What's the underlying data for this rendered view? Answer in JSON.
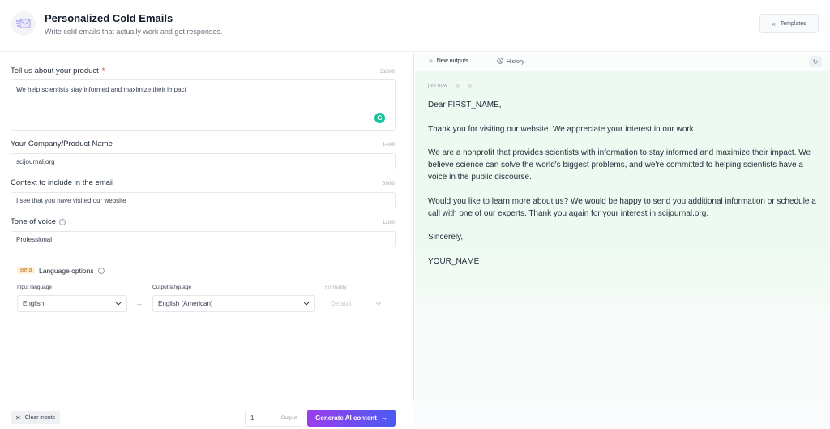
{
  "header": {
    "title": "Personalized Cold Emails",
    "subtitle": "Write cold emails that actually work and get responses.",
    "templates_label": "Templates"
  },
  "form": {
    "product": {
      "label": "Tell us about your product",
      "required_mark": "*",
      "counter": "58/600",
      "value": "We help scientists stay informed and maximize their impact"
    },
    "company": {
      "label": "Your Company/Product Name",
      "counter": "14/80",
      "value": "scijournal.org"
    },
    "context": {
      "label": "Context to include in the email",
      "counter": "39/80",
      "value": "I see that you have visited our website"
    },
    "tone": {
      "label": "Tone of voice",
      "counter": "12/80",
      "value": "Professional"
    },
    "language": {
      "beta_label": "Beta",
      "title": "Language options",
      "input_label": "Input language",
      "input_value": "English",
      "output_label": "Output language",
      "output_value": "English (American)",
      "formality_label": "Formality",
      "formality_value": "Default"
    }
  },
  "footer": {
    "clear_label": "Clear inputs",
    "output_count": "1",
    "output_unit": "Output",
    "generate_label": "Generate AI content"
  },
  "output": {
    "tabs": [
      {
        "label": "New outputs"
      },
      {
        "label": "History"
      }
    ],
    "timestamp": "just now",
    "email_paragraphs": [
      "Dear FIRST_NAME,",
      "Thank you for visiting our website. We appreciate your interest in our work.",
      "We are a nonprofit that provides scientists with information to stay informed and maximize their impact. We believe science can solve the world's biggest problems, and we're committed to helping scientists have a voice in the public discourse.",
      "Would you like to learn more about us? We would be happy to send you additional information or schedule a call with one of our experts. Thank you again for your interest in scijournal.org.",
      "Sincerely,",
      "YOUR_NAME"
    ]
  },
  "icons": {
    "app": "email-envelope-icon",
    "templates": "double-chevron-left-icon",
    "grammarly": "grammarly-icon",
    "info": "info-circle-icon",
    "chevron": "chevron-down-icon",
    "arrow_between": "arrow-right-icon",
    "clear": "x-icon",
    "generate": "arrow-right-icon",
    "new_outputs": "sparkle-icon",
    "history": "clock-icon",
    "refresh": "refresh-icon"
  },
  "colors": {
    "generate_gradient_start": "#9b3dee",
    "generate_gradient_end": "#4a5af0",
    "output_background": "#eefaf1",
    "required": "#ef4444",
    "beta_background": "#fdf0d5",
    "grammarly": "#15c39a"
  }
}
